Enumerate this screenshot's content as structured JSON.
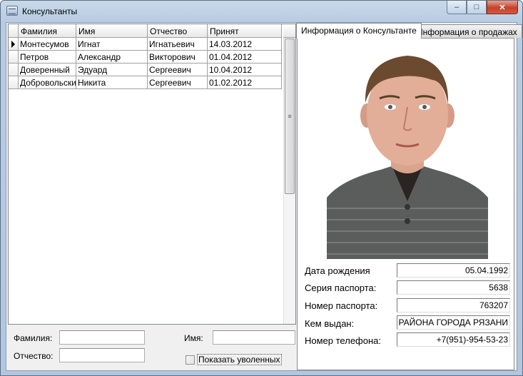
{
  "window": {
    "title": "Консультанты",
    "buttons": {
      "minimize": "‒",
      "maximize": "□",
      "close": "✕"
    }
  },
  "grid": {
    "columns": [
      "Фамилия",
      "Имя",
      "Отчество",
      "Принят"
    ],
    "rows": [
      {
        "last": "Монтесумов",
        "first": "Игнат",
        "middle": "Игнатьевич",
        "hired": "14.03.2012",
        "current": true
      },
      {
        "last": "Петров",
        "first": "Александр",
        "middle": "Викторович",
        "hired": "01.04.2012",
        "current": false
      },
      {
        "last": "Доверенный",
        "first": "Эдуард",
        "middle": "Сергеевич",
        "hired": "10.04.2012",
        "current": false
      },
      {
        "last": "Добровольский",
        "first": "Никита",
        "middle": "Сергеевич",
        "hired": "01.02.2012",
        "current": false
      }
    ]
  },
  "filters": {
    "last_name_label": "Фамилия:",
    "first_name_label": "Имя:",
    "middle_name_label": "Отчество:",
    "last_name_value": "",
    "first_name_value": "",
    "middle_name_value": "",
    "show_fired_label": "Показать уволенных",
    "show_fired_checked": false
  },
  "tabs": [
    {
      "label": "Информация о Консультанте",
      "active": true
    },
    {
      "label": "Информация о продажах",
      "active": false
    }
  ],
  "details": {
    "birth_date_label": "Дата рождения",
    "birth_date": "05.04.1992",
    "passport_series_label": "Серия паспорта:",
    "passport_series": "5638",
    "passport_number_label": "Номер паспорта:",
    "passport_number": "763207",
    "issued_by_label": "Кем выдан:",
    "issued_by": "ГО РАЙОНА ГОРОДА РЯЗАНИ",
    "phone_label": "Номер телефона:",
    "phone": "+7(951)-954-53-23"
  },
  "colors": {
    "accent_close": "#c6402a",
    "title_bar": "#b7cbe1"
  }
}
